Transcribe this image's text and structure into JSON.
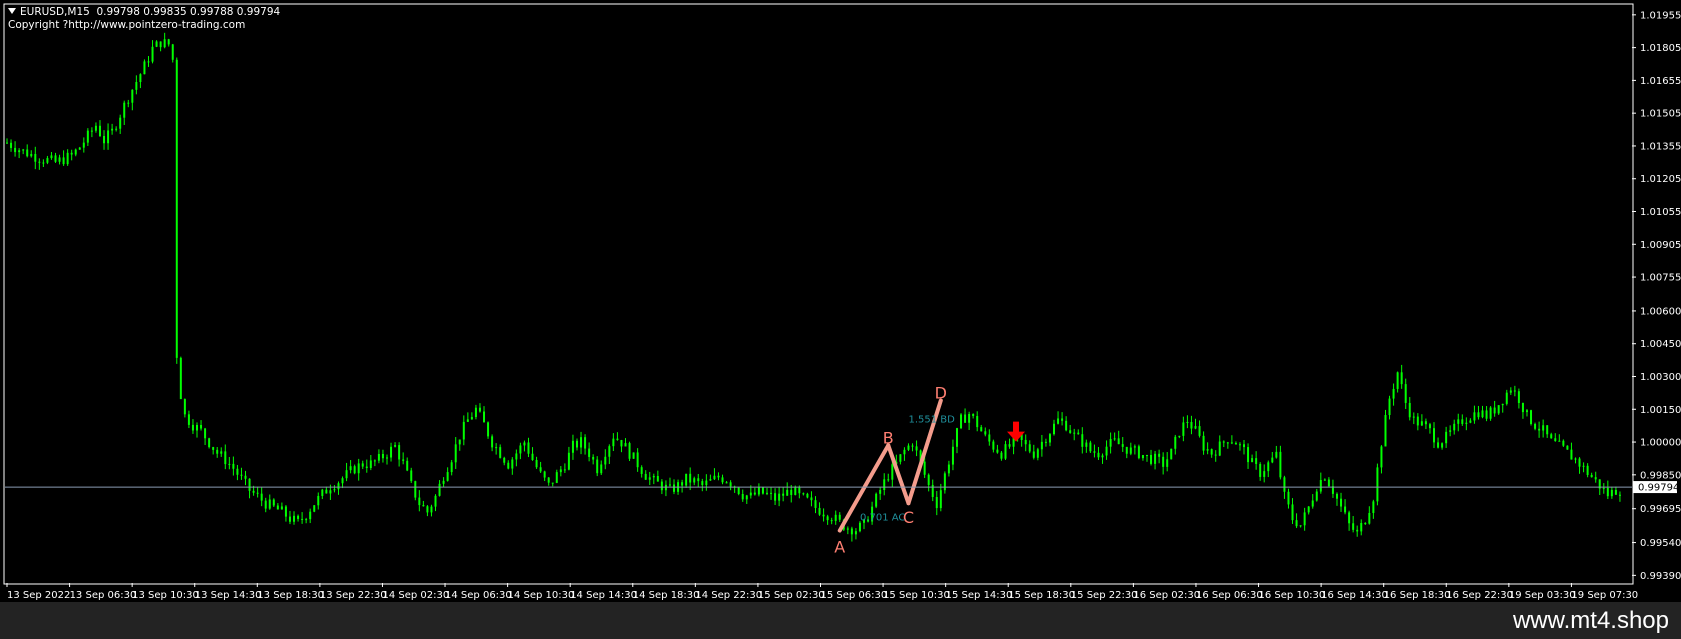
{
  "watermark": "www.mt4.shop",
  "header": {
    "symbol": "EURUSD,M15",
    "ohlc": "0.99798 0.99835 0.99788 0.99794",
    "copyright": "Copyright ?http://www.pointzero-trading.com"
  },
  "colors": {
    "background": "#000000",
    "candle": "#00ff00",
    "frame": "#ffffff",
    "bid_line": "#8a9bb3",
    "pattern_up": "#f49c8c",
    "pattern_label": "#ff7f72",
    "ratio_label": "#1f8f9b",
    "signal": "#ff0000"
  },
  "chart_data": {
    "type": "candlestick",
    "y_ticks": [
      "1.01955",
      "1.01805",
      "1.01655",
      "1.01505",
      "1.01355",
      "1.01205",
      "1.01055",
      "1.00905",
      "1.00755",
      "1.00600",
      "1.00450",
      "1.00300",
      "1.00150",
      "1.00000",
      "0.99850",
      "0.99695",
      "0.99540",
      "0.99390"
    ],
    "ylim": [
      0.99355,
      1.02
    ],
    "x_ticks": [
      "13 Sep 2022",
      "13 Sep 06:30",
      "13 Sep 10:30",
      "13 Sep 14:30",
      "13 Sep 18:30",
      "13 Sep 22:30",
      "14 Sep 02:30",
      "14 Sep 06:30",
      "14 Sep 10:30",
      "14 Sep 14:30",
      "14 Sep 18:30",
      "14 Sep 22:30",
      "15 Sep 02:30",
      "15 Sep 06:30",
      "15 Sep 10:30",
      "15 Sep 14:30",
      "15 Sep 18:30",
      "15 Sep 22:30",
      "16 Sep 02:30",
      "16 Sep 06:30",
      "16 Sep 10:30",
      "16 Sep 14:30",
      "16 Sep 18:30",
      "16 Sep 22:30",
      "19 Sep 03:30",
      "19 Sep 07:30"
    ],
    "current_price": "0.99794",
    "price_path": [
      [
        0,
        1.0137
      ],
      [
        2,
        1.0133
      ],
      [
        4,
        1.013
      ],
      [
        6,
        1.0128
      ],
      [
        8,
        1.0131
      ],
      [
        9,
        1.0135
      ],
      [
        10,
        1.014
      ],
      [
        11,
        1.0145
      ],
      [
        12,
        1.0138
      ],
      [
        13,
        1.0142
      ],
      [
        14,
        1.015
      ],
      [
        15,
        1.0158
      ],
      [
        16,
        1.0165
      ],
      [
        17,
        1.0172
      ],
      [
        18,
        1.018
      ],
      [
        19,
        1.0183
      ],
      [
        20,
        1.0182
      ],
      [
        20.5,
        1.0175
      ],
      [
        20.8,
        1.008
      ],
      [
        21.0,
        1.004
      ],
      [
        21.3,
        1.0025
      ],
      [
        21.6,
        1.002
      ],
      [
        22,
        1.0012
      ],
      [
        23,
        1.0008
      ],
      [
        24,
        1.0005
      ],
      [
        25,
        1.0
      ],
      [
        26,
        0.9995
      ],
      [
        27,
        0.9992
      ],
      [
        28,
        0.9988
      ],
      [
        29,
        0.9983
      ],
      [
        30,
        0.9978
      ],
      [
        31,
        0.9975
      ],
      [
        32,
        0.9972
      ],
      [
        33,
        0.997
      ],
      [
        34,
        0.9968
      ],
      [
        35,
        0.9965
      ],
      [
        36,
        0.9963
      ],
      [
        37,
        0.9967
      ],
      [
        38,
        0.9972
      ],
      [
        39,
        0.9976
      ],
      [
        40,
        0.998
      ],
      [
        41,
        0.9982
      ],
      [
        42,
        0.9985
      ],
      [
        43,
        0.9988
      ],
      [
        44,
        0.999
      ],
      [
        45,
        0.999
      ],
      [
        46,
        0.9992
      ],
      [
        47,
        0.9995
      ],
      [
        48,
        0.9998
      ],
      [
        49,
        0.999
      ],
      [
        50,
        0.998
      ],
      [
        51,
        0.9972
      ],
      [
        52,
        0.9968
      ],
      [
        53,
        0.9975
      ],
      [
        54,
        0.9985
      ],
      [
        55,
        0.9993
      ],
      [
        56,
        1.0003
      ],
      [
        57,
        1.001
      ],
      [
        58,
        1.0015
      ],
      [
        59,
        1.0008
      ],
      [
        60,
        1.0
      ],
      [
        61,
        0.9995
      ],
      [
        62,
        0.999
      ],
      [
        63,
        0.9995
      ],
      [
        64,
        1.0
      ],
      [
        65,
        0.9992
      ],
      [
        66,
        0.9985
      ],
      [
        67,
        0.998
      ],
      [
        68,
        0.9985
      ],
      [
        69,
        0.999
      ],
      [
        70,
        0.9998
      ],
      [
        71,
        1.0
      ],
      [
        72,
        0.9995
      ],
      [
        73,
        0.9988
      ],
      [
        74,
        0.9996
      ],
      [
        75,
        1.0003
      ],
      [
        76,
        1.0
      ],
      [
        77,
        0.9995
      ],
      [
        78,
        0.999
      ],
      [
        79,
        0.9985
      ],
      [
        80,
        0.9982
      ],
      [
        81,
        0.998
      ],
      [
        82,
        0.9978
      ],
      [
        83,
        0.998
      ],
      [
        84,
        0.9983
      ],
      [
        85,
        0.9982
      ],
      [
        86,
        0.998
      ],
      [
        87,
        0.9982
      ],
      [
        88,
        0.9984
      ],
      [
        89,
        0.9983
      ],
      [
        90,
        0.998
      ],
      [
        91,
        0.9976
      ],
      [
        92,
        0.9975
      ],
      [
        93,
        0.9977
      ],
      [
        94,
        0.9976
      ],
      [
        95,
        0.9974
      ],
      [
        96,
        0.9976
      ],
      [
        97,
        0.9978
      ],
      [
        98,
        0.9975
      ],
      [
        99,
        0.9973
      ],
      [
        100,
        0.997
      ],
      [
        101,
        0.9968
      ],
      [
        102,
        0.9966
      ],
      [
        103,
        0.9963
      ],
      [
        104,
        0.9961
      ],
      [
        105,
        0.996
      ],
      [
        106,
        0.9962
      ],
      [
        107,
        0.997
      ],
      [
        108,
        0.9978
      ],
      [
        109,
        0.9985
      ],
      [
        110,
        0.999
      ],
      [
        111,
        0.9996
      ],
      [
        112,
        1.0
      ],
      [
        113,
        0.999
      ],
      [
        114,
        0.998
      ],
      [
        115,
        0.9972
      ],
      [
        116,
        0.9985
      ],
      [
        117,
        0.9998
      ],
      [
        118,
        1.001
      ],
      [
        119,
        1.0013
      ],
      [
        120,
        1.0008
      ],
      [
        121,
        1.0002
      ],
      [
        122,
        0.9998
      ],
      [
        123,
        0.9995
      ],
      [
        124,
        0.9998
      ],
      [
        125,
        1.0002
      ],
      [
        126,
        0.9998
      ],
      [
        127,
        0.9995
      ],
      [
        128,
        1.0
      ],
      [
        129,
        1.0005
      ],
      [
        130,
        1.001
      ],
      [
        131,
        1.0008
      ],
      [
        132,
        1.0003
      ],
      [
        133,
        1.0
      ],
      [
        134,
        0.9996
      ],
      [
        135,
        0.9995
      ],
      [
        136,
        0.9998
      ],
      [
        137,
        1.0
      ],
      [
        138,
        0.9998
      ],
      [
        139,
        0.9996
      ],
      [
        140,
        0.9995
      ],
      [
        141,
        0.9993
      ],
      [
        142,
        0.9992
      ],
      [
        143,
        0.999
      ],
      [
        144,
        0.9995
      ],
      [
        145,
        1.0005
      ],
      [
        146,
        1.001
      ],
      [
        147,
        1.0005
      ],
      [
        148,
        0.9998
      ],
      [
        149,
        0.9995
      ],
      [
        150,
        0.9998
      ],
      [
        151,
        1.0002
      ],
      [
        152,
        1.0
      ],
      [
        153,
        0.9996
      ],
      [
        154,
        0.999
      ],
      [
        155,
        0.9986
      ],
      [
        156,
        0.999
      ],
      [
        157,
        0.9994
      ],
      [
        158,
        0.9975
      ],
      [
        159,
        0.9965
      ],
      [
        160,
        0.9962
      ],
      [
        161,
        0.997
      ],
      [
        162,
        0.998
      ],
      [
        163,
        0.9985
      ],
      [
        164,
        0.9978
      ],
      [
        165,
        0.997
      ],
      [
        166,
        0.9962
      ],
      [
        167,
        0.9958
      ],
      [
        168,
        0.9965
      ],
      [
        169,
        0.9975
      ],
      [
        170,
        1.0
      ],
      [
        171,
        1.002
      ],
      [
        172,
        1.0032
      ],
      [
        173,
        1.0018
      ],
      [
        174,
        1.001
      ],
      [
        175,
        1.0008
      ],
      [
        176,
        1.0005
      ],
      [
        177,
        1.0
      ],
      [
        178,
        1.0002
      ],
      [
        179,
        1.0006
      ],
      [
        180,
        1.001
      ],
      [
        181,
        1.0012
      ],
      [
        182,
        1.0014
      ],
      [
        183,
        1.0012
      ],
      [
        184,
        1.0015
      ],
      [
        185,
        1.002
      ],
      [
        186,
        1.0025
      ],
      [
        187,
        1.002
      ],
      [
        188,
        1.0012
      ],
      [
        189,
        1.0008
      ],
      [
        190,
        1.0005
      ],
      [
        191,
        1.0
      ],
      [
        192,
        0.9998
      ],
      [
        193,
        0.9995
      ],
      [
        194,
        0.9992
      ],
      [
        195,
        0.9988
      ],
      [
        196,
        0.9984
      ],
      [
        197,
        0.998
      ],
      [
        198,
        0.9976
      ],
      [
        199,
        0.9978
      ]
    ],
    "pattern": {
      "type": "ABCD",
      "points": {
        "A": {
          "bar": 103,
          "price": 0.99595
        },
        "B": {
          "bar": 109,
          "price": 0.99985
        },
        "C": {
          "bar": 111.5,
          "price": 0.9972
        },
        "D": {
          "bar": 115.5,
          "price": 1.0019
        }
      },
      "labels": [
        "A",
        "B",
        "C",
        "D"
      ],
      "ratios": [
        {
          "text": "0.701 AC",
          "bar": 105.5,
          "price": 0.9964
        },
        {
          "text": "1.551 BD",
          "bar": 111.5,
          "price": 1.0009
        }
      ]
    },
    "signal_arrow": {
      "bar": 124.8,
      "price": 1.0002,
      "direction": "down"
    }
  }
}
